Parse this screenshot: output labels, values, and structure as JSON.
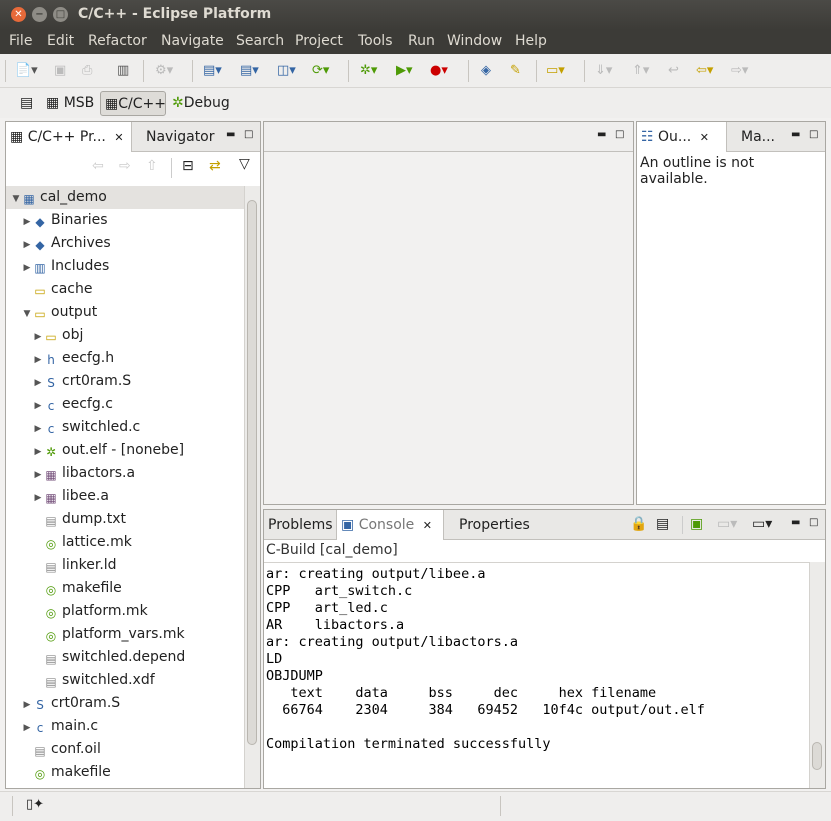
{
  "window": {
    "title": "C/C++ - Eclipse Platform"
  },
  "menu": [
    "File",
    "Edit",
    "Refactor",
    "Navigate",
    "Search",
    "Project",
    "Tools",
    "Run",
    "Window",
    "Help"
  ],
  "perspectives": {
    "msb": "MSB",
    "cpp": "C/C++",
    "debug": "Debug"
  },
  "project_explorer": {
    "tabs": {
      "cpp": "C/C++ Pr...",
      "navigator": "Navigator"
    },
    "items": [
      {
        "label": "cal_demo",
        "icon": "c-project-icon",
        "depth": 0,
        "twisty": "open"
      },
      {
        "label": "Binaries",
        "icon": "binaries-icon",
        "depth": 1,
        "twisty": "closed"
      },
      {
        "label": "Archives",
        "icon": "archives-icon",
        "depth": 1,
        "twisty": "closed"
      },
      {
        "label": "Includes",
        "icon": "includes-icon",
        "depth": 1,
        "twisty": "closed"
      },
      {
        "label": "cache",
        "icon": "folder-icon",
        "depth": 1,
        "twisty": "none"
      },
      {
        "label": "output",
        "icon": "folder-open-icon",
        "depth": 1,
        "twisty": "open"
      },
      {
        "label": "obj",
        "icon": "folder-icon",
        "depth": 2,
        "twisty": "closed"
      },
      {
        "label": "eecfg.h",
        "icon": "h-file-icon",
        "depth": 2,
        "twisty": "closed"
      },
      {
        "label": "crt0ram.S",
        "icon": "s-file-icon",
        "depth": 2,
        "twisty": "closed"
      },
      {
        "label": "eecfg.c",
        "icon": "c-file-icon",
        "depth": 2,
        "twisty": "closed"
      },
      {
        "label": "switchled.c",
        "icon": "c-file-icon",
        "depth": 2,
        "twisty": "closed"
      },
      {
        "label": "out.elf - [nonebe]",
        "icon": "binary-bug-icon",
        "depth": 2,
        "twisty": "closed"
      },
      {
        "label": "libactors.a",
        "icon": "archive-file-icon",
        "depth": 2,
        "twisty": "closed"
      },
      {
        "label": "libee.a",
        "icon": "archive-file-icon",
        "depth": 2,
        "twisty": "closed"
      },
      {
        "label": "dump.txt",
        "icon": "text-file-icon",
        "depth": 2,
        "twisty": "none"
      },
      {
        "label": "lattice.mk",
        "icon": "make-file-icon",
        "depth": 2,
        "twisty": "none"
      },
      {
        "label": "linker.ld",
        "icon": "text-file-icon",
        "depth": 2,
        "twisty": "none"
      },
      {
        "label": "makefile",
        "icon": "make-file-icon",
        "depth": 2,
        "twisty": "none"
      },
      {
        "label": "platform.mk",
        "icon": "make-file-icon",
        "depth": 2,
        "twisty": "none"
      },
      {
        "label": "platform_vars.mk",
        "icon": "make-file-icon",
        "depth": 2,
        "twisty": "none"
      },
      {
        "label": "switchled.depend",
        "icon": "text-file-icon",
        "depth": 2,
        "twisty": "none"
      },
      {
        "label": "switchled.xdf",
        "icon": "text-file-icon",
        "depth": 2,
        "twisty": "none"
      },
      {
        "label": "crt0ram.S",
        "icon": "s-file-icon",
        "depth": 1,
        "twisty": "closed"
      },
      {
        "label": "main.c",
        "icon": "c-file-icon",
        "depth": 1,
        "twisty": "closed"
      },
      {
        "label": "conf.oil",
        "icon": "text-file-icon",
        "depth": 1,
        "twisty": "none"
      },
      {
        "label": "makefile",
        "icon": "make-file-icon",
        "depth": 1,
        "twisty": "none"
      }
    ]
  },
  "outline": {
    "tabs": {
      "outline": "Ou...",
      "make": "Ma..."
    },
    "message": "An outline is not available."
  },
  "bottom": {
    "tabs": {
      "problems": "Problems",
      "console": "Console",
      "properties": "Properties"
    },
    "console_title": "C-Build [cal_demo]",
    "lines": [
      "ar: creating output/libee.a",
      "CPP   art_switch.c",
      "CPP   art_led.c",
      "AR    libactors.a",
      "ar: creating output/libactors.a",
      "LD",
      "OBJDUMP",
      "   text    data     bss     dec     hex filename",
      "  66764    2304     384   69452   10f4c output/out.elf",
      "",
      "Compilation terminated successfully"
    ]
  },
  "colors": {
    "titlebar": "#3c3b37",
    "selection": "#dedcd8",
    "accent": "#f07746"
  }
}
